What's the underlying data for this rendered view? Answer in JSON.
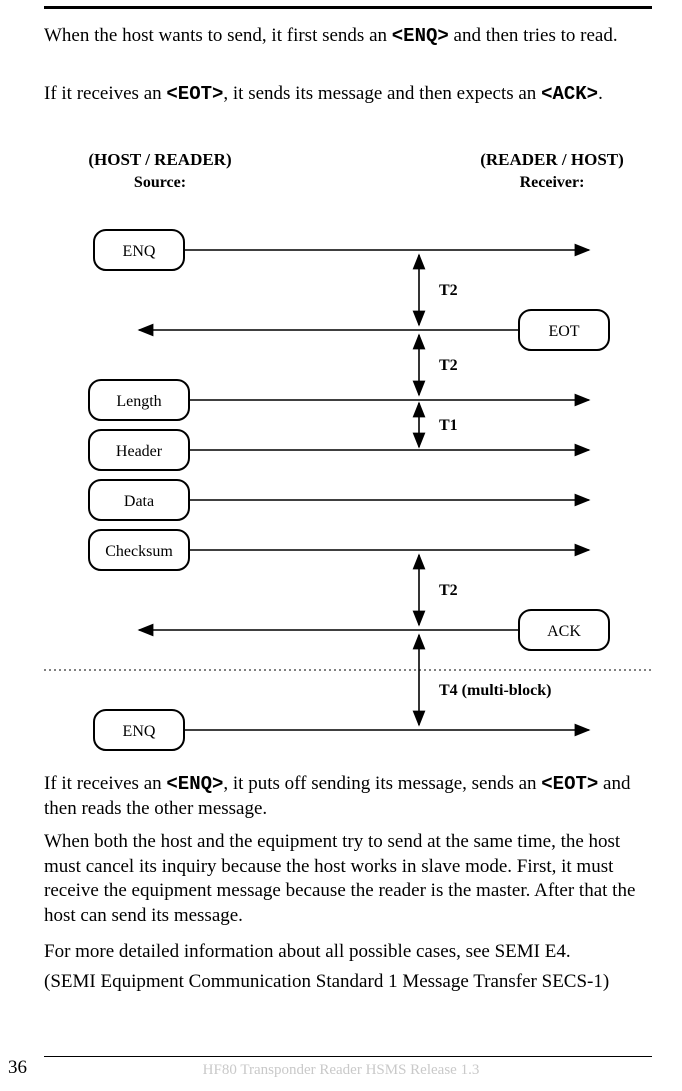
{
  "para1_a": "When the host wants to send, it first sends an ",
  "para1_code": "<ENQ>",
  "para1_b": " and then tries to read.",
  "para2_a": "If it receives an ",
  "para2_code": "<EOT>",
  "para2_b": ", it sends its message and then expects an ",
  "para2_code2": "<ACK>",
  "para2_c": ".",
  "diagram": {
    "left_header": "(HOST / READER)",
    "left_sub": "Source:",
    "right_header": "(READER / HOST)",
    "right_sub": "Receiver:",
    "enq1": "ENQ",
    "eot": "EOT",
    "length": "Length",
    "header": "Header",
    "data": "Data",
    "checksum": "Checksum",
    "ack": "ACK",
    "enq2": "ENQ",
    "t2": "T2",
    "t1": "T1",
    "t4": "T4 (multi-block)"
  },
  "para3_a": "If it receives an ",
  "para3_code": "<ENQ>",
  "para3_b": ", it puts off sending its message, sends an ",
  "para3_code2": "<EOT>",
  "para3_c": " and then reads the other message.",
  "para4": "When both the host and the equipment try to send at the same time, the host must cancel its inquiry because the host works in slave mode. First, it must receive the equipment message because the reader is the master. After that the host can send its message.",
  "para5": "For more detailed information about all possible cases, see SEMI E4.",
  "para6": "(SEMI Equipment Communication Standard 1 Message Transfer SECS-1)",
  "page_num": "36",
  "footer": "HF80 Transponder Reader    HSMS   Release 1.3"
}
